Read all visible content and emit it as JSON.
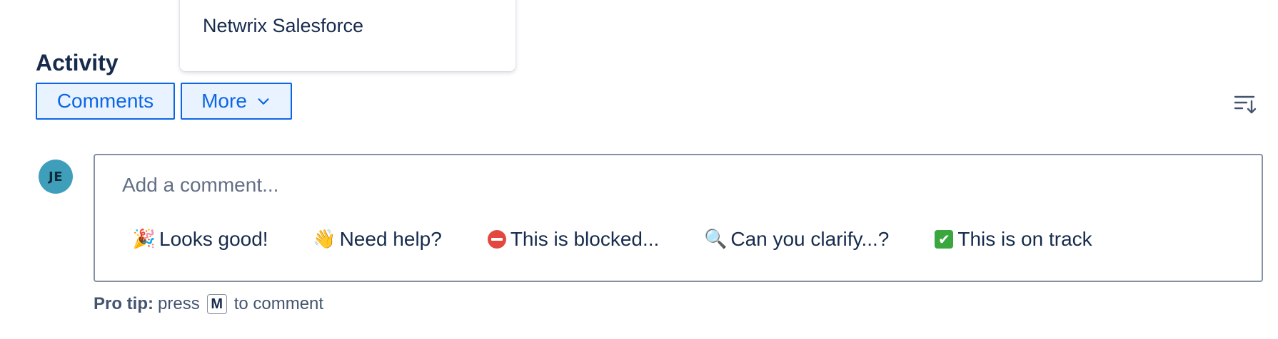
{
  "dropdown": {
    "items": [
      {
        "label": "Netwrix Salesforce"
      }
    ]
  },
  "activity": {
    "title": "Activity",
    "filters": {
      "comments_label": "Comments",
      "more_label": "More"
    },
    "sort_icon": "sort-descending-icon"
  },
  "comment": {
    "avatar_initials": "JE",
    "avatar_color": "#3f9fbb",
    "placeholder": "Add a comment...",
    "quick_replies": [
      {
        "emoji": "🎉",
        "icon": "party-popper-icon",
        "label": "Looks good!"
      },
      {
        "emoji": "👋",
        "icon": "waving-hand-icon",
        "label": "Need help?"
      },
      {
        "emoji": "⛔",
        "icon": "no-entry-icon",
        "label": "This is blocked..."
      },
      {
        "emoji": "🔍",
        "icon": "magnifying-glass-icon",
        "label": "Can you clarify...?"
      },
      {
        "emoji": "✔",
        "icon": "check-mark-button-icon",
        "label": "This is on track"
      }
    ]
  },
  "pro_tip": {
    "prefix": "Pro tip:",
    "before_key": "press",
    "key": "M",
    "after_key": "to comment"
  },
  "colors": {
    "accent": "#0c66e4",
    "accent_bg": "#e9f2ff",
    "border": "#8590a2",
    "text": "#172b4d",
    "subtle_text": "#626f86"
  }
}
